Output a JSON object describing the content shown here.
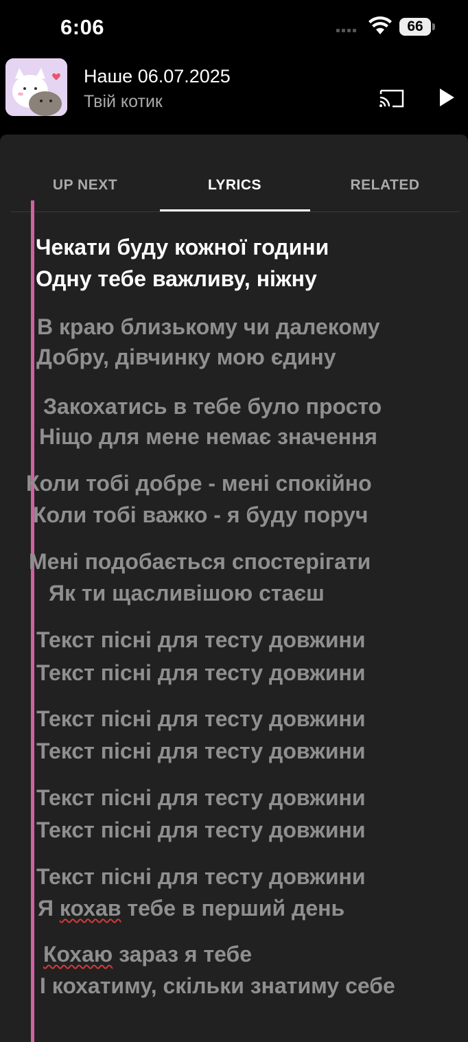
{
  "status_bar": {
    "time": "6:06",
    "battery": "66",
    "icons": [
      "signal-icon",
      "wifi-icon",
      "battery-icon"
    ]
  },
  "player": {
    "title": "Наше 06.07.2025",
    "artist": "Твій котик",
    "icons": [
      "album-art",
      "cast-icon",
      "play-icon"
    ]
  },
  "tabs": [
    {
      "label": "UP NEXT",
      "active": false
    },
    {
      "label": "LYRICS",
      "active": true
    },
    {
      "label": "RELATED",
      "active": false
    }
  ],
  "lyrics": {
    "lines": [
      "Чекати буду кожної години",
      "Одну тебе важливу, ніжну",
      "В краю близькому чи далекому",
      "Добру, дівчинку мою єдину",
      "Закохатись в тебе було просто",
      "Ніщо для мене немає значення",
      "Коли тобі добре - мені спокійно",
      "Коли тобі важко - я буду поруч",
      "Мені подобається спостерігати",
      "Як ти щасливішою стаєш",
      "Текст пісні для тесту довжини",
      "Текст пісні для тесту довжини",
      "Текст пісні для тесту довжини",
      "Текст пісні для тесту довжини",
      "Текст пісні для тесту довжини",
      "Текст пісні для тесту довжини",
      "Текст пісні для тесту довжини",
      "Я кохав тебе в перший день",
      "Кохаю зараз я тебе",
      "І кохатиму, скільки знатиму себе"
    ],
    "line17_parts": [
      "Я ",
      "кохав",
      " тебе в перший день"
    ],
    "line18_parts": [
      "Кохаю",
      " зараз я тебе"
    ]
  },
  "colors": {
    "background": "#000000",
    "panel": "#212121",
    "accent": "#d061a3",
    "current_lyric": "#ffffff",
    "lyric": "#8f8f8f",
    "spellcheck": "#d13b3b"
  }
}
